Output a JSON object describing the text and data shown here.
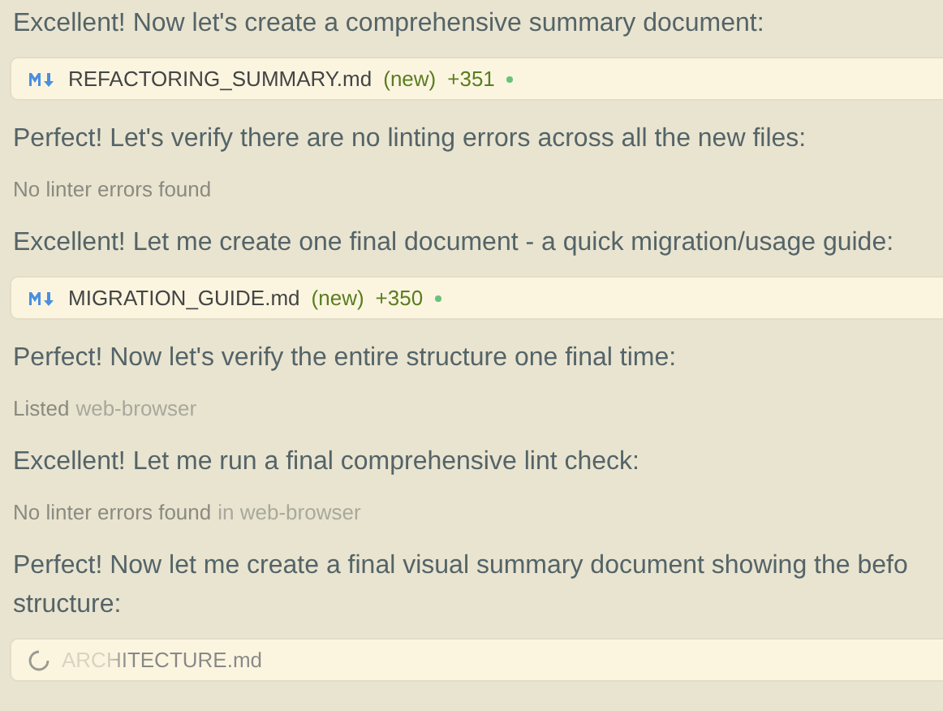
{
  "items": [
    {
      "kind": "message",
      "lines": [
        "Excellent! Now let's create a comprehensive summary document:"
      ]
    },
    {
      "kind": "file",
      "name": "REFACTORING_SUMMARY.md",
      "status": "(new)",
      "added": "+351",
      "pending": false
    },
    {
      "kind": "message",
      "lines": [
        "Perfect! Let's verify there are no linting errors across all the new files:"
      ]
    },
    {
      "kind": "tool",
      "text": "No linter errors found"
    },
    {
      "kind": "message",
      "lines": [
        "Excellent! Let me create one final document - a quick migration/usage guide:"
      ]
    },
    {
      "kind": "file",
      "name": "MIGRATION_GUIDE.md",
      "status": "(new)",
      "added": "+350",
      "pending": false
    },
    {
      "kind": "message",
      "lines": [
        "Perfect! Now let's verify the entire structure one final time:"
      ]
    },
    {
      "kind": "tool",
      "text": "Listed",
      "target": "web-browser"
    },
    {
      "kind": "message",
      "lines": [
        "Excellent! Let me run a final comprehensive lint check:"
      ]
    },
    {
      "kind": "tool",
      "text": "No linter errors found",
      "target": "in web-browser"
    },
    {
      "kind": "message",
      "lines": [
        "Perfect! Now let me create a final visual summary document showing the befo",
        "structure:"
      ]
    },
    {
      "kind": "file",
      "name": "ARCHITECTURE.md",
      "pending": true
    }
  ]
}
